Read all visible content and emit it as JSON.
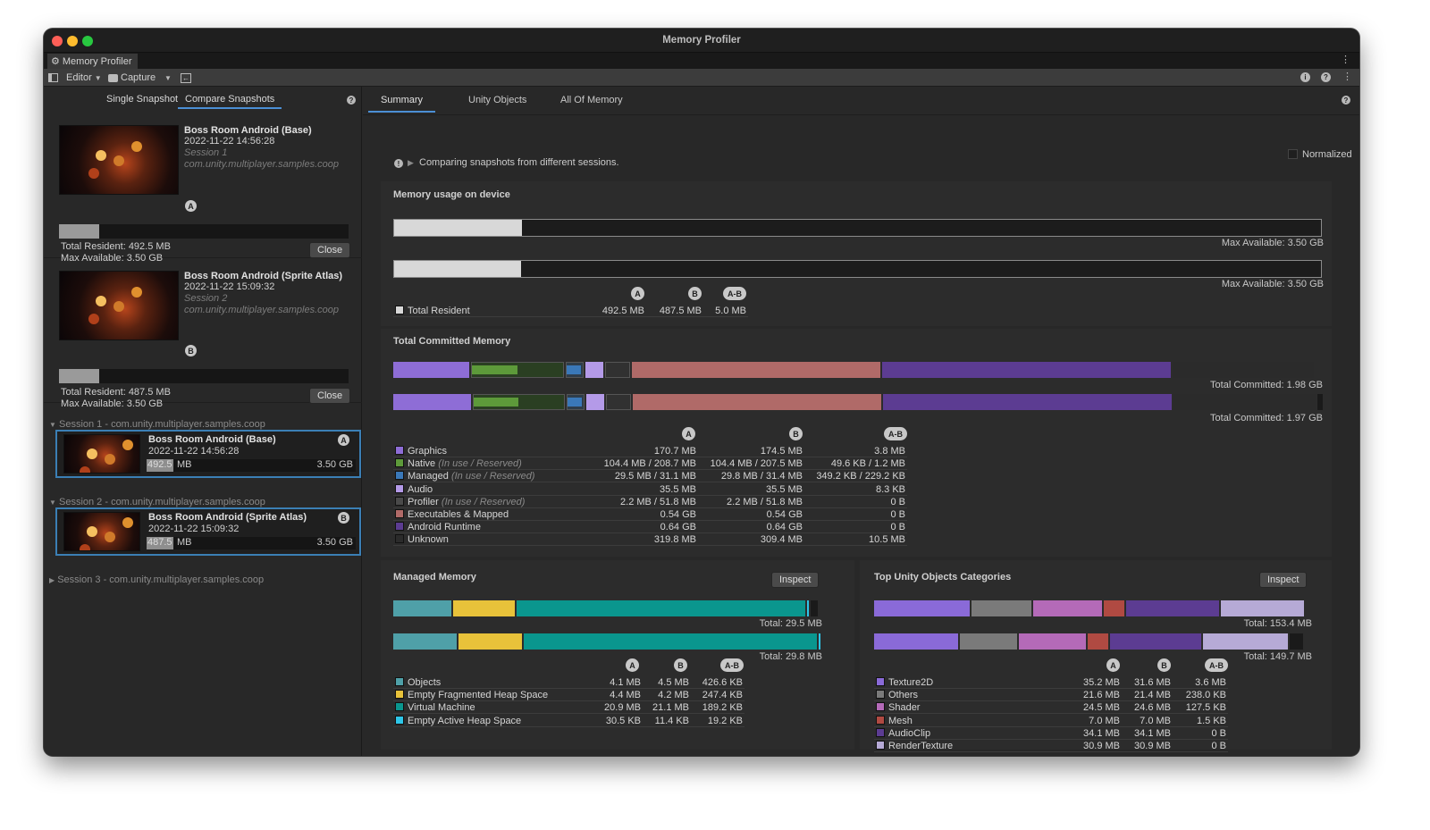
{
  "window": {
    "title": "Memory Profiler",
    "tab": "Memory Profiler"
  },
  "toolbar": {
    "editor": "Editor",
    "capture": "Capture"
  },
  "left": {
    "modes": [
      "Single Snapshot",
      "Compare Snapshots"
    ],
    "snapA": {
      "title": "Boss Room Android (Base)",
      "date": "2022-11-22 14:56:28",
      "session": "Session 1",
      "package": "com.unity.multiplayer.samples.coop",
      "badge": "A",
      "resident": "Total Resident: 492.5 MB",
      "max": "Max Available: 3.50 GB",
      "fill": 0.14,
      "close": "Close"
    },
    "snapB": {
      "title": "Boss Room Android (Sprite Atlas)",
      "date": "2022-11-22 15:09:32",
      "session": "Session 2",
      "package": "com.unity.multiplayer.samples.coop",
      "badge": "B",
      "resident": "Total Resident: 487.5 MB",
      "max": "Max Available: 3.50 GB",
      "fill": 0.139,
      "close": "Close"
    },
    "sessions": [
      {
        "label": "Session 1 - com.unity.multiplayer.samples.coop",
        "item": {
          "title": "Boss Room Android (Base)",
          "date": "2022-11-22 14:56:28",
          "badge": "A",
          "used": "492.5",
          "unit": "MB",
          "max": "3.50 GB"
        }
      },
      {
        "label": "Session 2 - com.unity.multiplayer.samples.coop",
        "item": {
          "title": "Boss Room Android (Sprite Atlas)",
          "date": "2022-11-22 15:09:32",
          "badge": "B",
          "used": "487.5",
          "unit": "MB",
          "max": "3.50 GB"
        }
      },
      {
        "label": "Session 3 - com.unity.multiplayer.samples.coop"
      }
    ]
  },
  "main": {
    "tabs": [
      "Summary",
      "Unity Objects",
      "All Of Memory"
    ],
    "normalized": "Normalized",
    "notice": "Comparing snapshots from different sessions.",
    "device": {
      "title": "Memory usage on device",
      "max_a": "Max Available: 3.50 GB",
      "max_b": "Max Available: 3.50 GB",
      "fill_a": 0.138,
      "fill_b": 0.137,
      "cols": [
        "A",
        "B",
        "A-B"
      ],
      "row": {
        "name": "Total Resident",
        "a": "492.5 MB",
        "b": "487.5 MB",
        "d": "5.0 MB",
        "color": "#d8d8d8"
      }
    },
    "committed": {
      "title": "Total Committed Memory",
      "total_a": "Total Committed: 1.98 GB",
      "total_b": "Total Committed: 1.97 GB",
      "cols": [
        "A",
        "B",
        "A-B"
      ],
      "rows": [
        {
          "name": "Graphics",
          "hint": "",
          "a": "170.7 MB",
          "b": "174.5 MB",
          "d": "3.8 MB",
          "color": "#8e6dd6"
        },
        {
          "name": "Native",
          "hint": "(In use / Reserved)",
          "a": "104.4 MB / 208.7 MB",
          "b": "104.4 MB / 207.5 MB",
          "d": "49.6 KB / 1.2 MB",
          "color": "#5d9a3a"
        },
        {
          "name": "Managed",
          "hint": "(In use / Reserved)",
          "a": "29.5 MB / 31.1 MB",
          "b": "29.8 MB / 31.4 MB",
          "d": "349.2 KB / 229.2 KB",
          "color": "#3a78b8"
        },
        {
          "name": "Audio",
          "hint": "",
          "a": "35.5 MB",
          "b": "35.5 MB",
          "d": "8.3 KB",
          "color": "#b49ae8"
        },
        {
          "name": "Profiler",
          "hint": "(In use / Reserved)",
          "a": "2.2 MB / 51.8 MB",
          "b": "2.2 MB / 51.8 MB",
          "d": "0 B",
          "color": "#4a4a4a"
        },
        {
          "name": "Executables & Mapped",
          "hint": "",
          "a": "0.54 GB",
          "b": "0.54 GB",
          "d": "0 B",
          "color": "#b06a68"
        },
        {
          "name": "Android Runtime",
          "hint": "",
          "a": "0.64 GB",
          "b": "0.64 GB",
          "d": "0 B",
          "color": "#5c3c92"
        },
        {
          "name": "Unknown",
          "hint": "",
          "a": "319.8 MB",
          "b": "309.4 MB",
          "d": "10.5 MB",
          "color": "#2b2b2b"
        }
      ]
    },
    "managed": {
      "title": "Managed Memory",
      "inspect": "Inspect",
      "total_a": "Total: 29.5 MB",
      "total_b": "Total: 29.8 MB",
      "cols": [
        "A",
        "B",
        "A-B"
      ],
      "rows": [
        {
          "name": "Objects",
          "a": "4.1 MB",
          "b": "4.5 MB",
          "d": "426.6 KB",
          "color": "#4fa0a8"
        },
        {
          "name": "Empty Fragmented Heap Space",
          "a": "4.4 MB",
          "b": "4.2 MB",
          "d": "247.4 KB",
          "color": "#e8c23a"
        },
        {
          "name": "Virtual Machine",
          "a": "20.9 MB",
          "b": "21.1 MB",
          "d": "189.2 KB",
          "color": "#0a968e"
        },
        {
          "name": "Empty Active Heap Space",
          "a": "30.5 KB",
          "b": "11.4 KB",
          "d": "19.2 KB",
          "color": "#2ec6e8"
        }
      ]
    },
    "unity": {
      "title": "Top Unity Objects Categories",
      "inspect": "Inspect",
      "total_a": "Total: 153.4 MB",
      "total_b": "Total: 149.7 MB",
      "cols": [
        "A",
        "B",
        "A-B"
      ],
      "rows": [
        {
          "name": "Texture2D",
          "a": "35.2 MB",
          "b": "31.6 MB",
          "d": "3.6 MB",
          "color": "#8a6ad8"
        },
        {
          "name": "Others",
          "a": "21.6 MB",
          "b": "21.4 MB",
          "d": "238.0 KB",
          "color": "#7a7a7a"
        },
        {
          "name": "Shader",
          "a": "24.5 MB",
          "b": "24.6 MB",
          "d": "127.5 KB",
          "color": "#b46ab8"
        },
        {
          "name": "Mesh",
          "a": "7.0 MB",
          "b": "7.0 MB",
          "d": "1.5 KB",
          "color": "#b04a42"
        },
        {
          "name": "AudioClip",
          "a": "34.1 MB",
          "b": "34.1 MB",
          "d": "0 B",
          "color": "#5c3c92"
        },
        {
          "name": "RenderTexture",
          "a": "30.9 MB",
          "b": "30.9 MB",
          "d": "0 B",
          "color": "#b6aad6"
        }
      ]
    }
  }
}
